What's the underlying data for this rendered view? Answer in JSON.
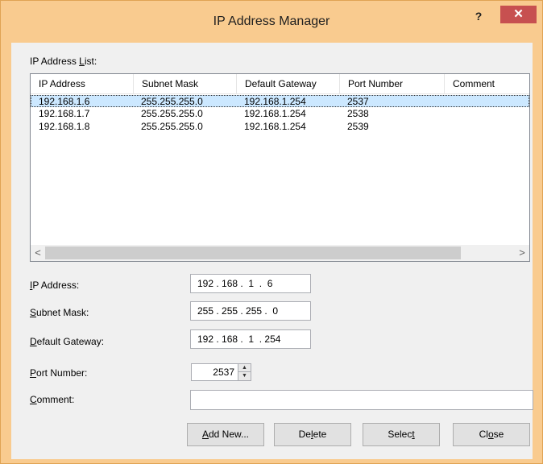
{
  "window": {
    "title": "IP Address Manager",
    "help_label": "?",
    "close_label": "✕"
  },
  "list": {
    "label_prefix": "IP Address ",
    "label_accel": "L",
    "label_suffix": "ist:",
    "columns": [
      "IP Address",
      "Subnet Mask",
      "Default Gateway",
      "Port Number",
      "Comment"
    ],
    "rows": [
      [
        "192.168.1.6",
        "255.255.255.0",
        "192.168.1.254",
        "2537",
        ""
      ],
      [
        "192.168.1.7",
        "255.255.255.0",
        "192.168.1.254",
        "2538",
        ""
      ],
      [
        "192.168.1.8",
        "255.255.255.0",
        "192.168.1.254",
        "2539",
        ""
      ]
    ],
    "selected_row": 0,
    "scroll_left": "<",
    "scroll_right": ">"
  },
  "form": {
    "ip": {
      "accel": "I",
      "rest": "P Address:",
      "value": "192 . 168 .  1  .  6"
    },
    "subnet": {
      "accel": "S",
      "rest": "ubnet Mask:",
      "value": "255 . 255 . 255 .  0"
    },
    "gateway": {
      "accel": "D",
      "rest": "efault Gateway:",
      "value": "192 . 168 .  1  . 254"
    },
    "port": {
      "accel": "P",
      "rest": "ort Number:",
      "value": "2537"
    },
    "comment": {
      "accel": "C",
      "rest": "omment:",
      "value": ""
    }
  },
  "buttons": {
    "add": {
      "accel": "A",
      "rest": "dd New..."
    },
    "delete": {
      "pre": "De",
      "accel": "l",
      "post": "ete"
    },
    "select": {
      "pre": "Selec",
      "accel": "t",
      "post": ""
    },
    "close": {
      "pre": "Cl",
      "accel": "o",
      "post": "se"
    }
  }
}
